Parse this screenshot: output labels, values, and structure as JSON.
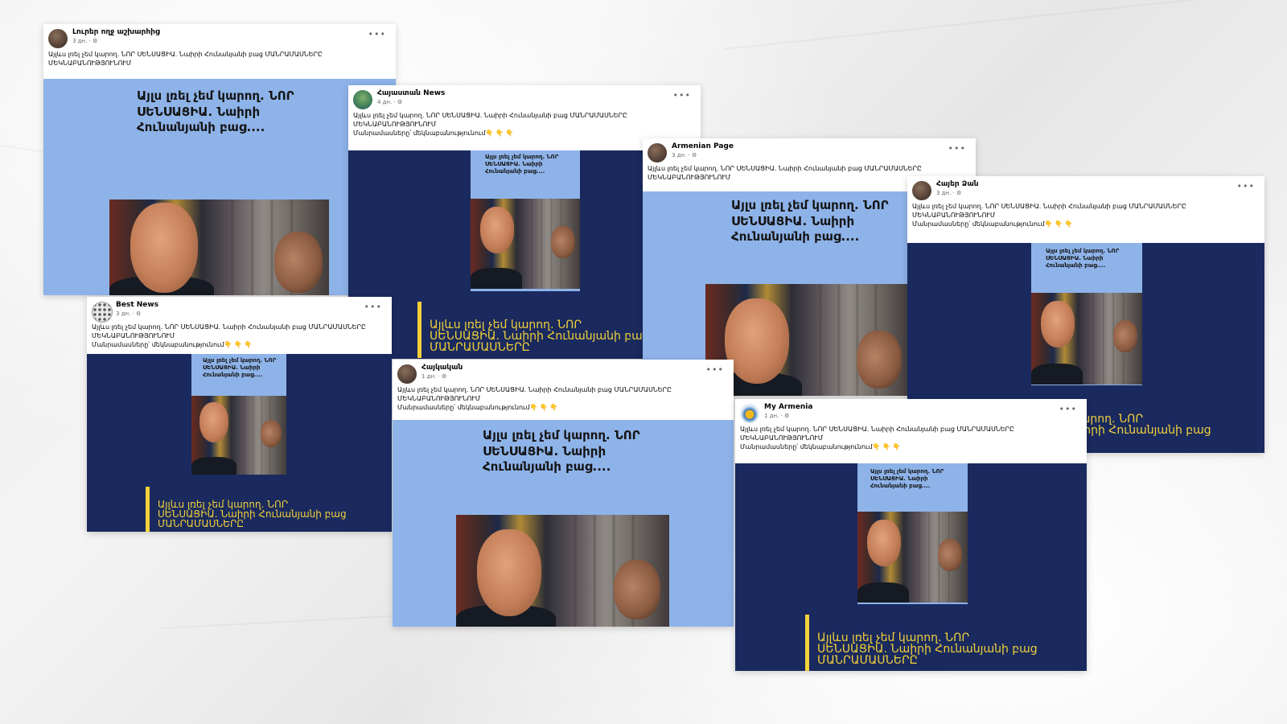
{
  "colors": {
    "light_blue": "#8eb3e9",
    "navy": "#1a2a5e",
    "yellow": "#f3d23a",
    "meta_gray": "#65676b"
  },
  "shared": {
    "text_line1": "Այլևս լռել չեմ կարող. ՆՈՐ ՍԵՆՍԱՑԻԱ. Նաիրի Հունանյանի բաց ՄԱՆՐԱՄԱՍՆԵՐԸ",
    "text_line2": "ՄԵԿՆԱԲԱՆՈՒԹՅՈՒՆՈՒՄ",
    "text_line3": "Մանրամասները՝ մեկնաբանությունում👇 👇 👇",
    "headline": [
      "Այլս լռել չեմ կարող. ՆՈՐ",
      "ՍԵՆՍԱՑԻԱ. Նաիրի",
      "Հունանյանի բաց...."
    ],
    "caption": [
      "Այլևս լռել չեմ կարող. ՆՈՐ",
      "ՍԵՆՍԱՑԻԱ. Նաիրի Հունանյանի բաց",
      "ՄԱՆՐԱՄԱՍՆԵՐԸ"
    ],
    "more_glyph": "•••"
  },
  "posts": [
    {
      "author": "Լուրեր ողջ աշխարհից",
      "meta": "3 дн. · ⚙"
    },
    {
      "author": "Հայաստան News",
      "meta": "4 дн. · ⚙"
    },
    {
      "author": "Armenian Page",
      "meta": "3 дн. · ⚙"
    },
    {
      "author": "Հայեր Ձան",
      "meta": "3 дн. · ⚙"
    },
    {
      "author": "Best News",
      "meta": "3 дн. · ⚙"
    },
    {
      "author": "Հայկական",
      "meta": "1 дн. · ⚙"
    },
    {
      "author": "My Armenia",
      "meta": "1 дн. · ⚙"
    }
  ]
}
